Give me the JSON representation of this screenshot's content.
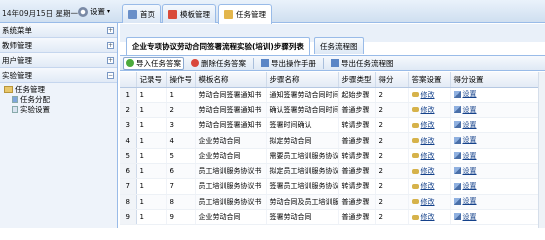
{
  "header": {
    "date_text": "14年09月15日 星期一",
    "settings_label": "设置"
  },
  "tabs": [
    {
      "label": "首页",
      "icon": "home-icon"
    },
    {
      "label": "模板管理",
      "icon": "pdf-icon"
    },
    {
      "label": "任务管理",
      "icon": "folder-icon"
    }
  ],
  "sidebar": {
    "sections": [
      {
        "label": "系统菜单",
        "toggle": "+"
      },
      {
        "label": "教师管理",
        "toggle": "+"
      },
      {
        "label": "用户管理",
        "toggle": "+"
      },
      {
        "label": "实验管理",
        "toggle": "−"
      }
    ],
    "tree": {
      "root": "任务管理",
      "children": [
        "任务分配",
        "实验设置"
      ]
    }
  },
  "subtabs": [
    {
      "label": "企业专项协议劳动合同签署流程实验(培训)步骤列表"
    },
    {
      "label": "任务流程图"
    }
  ],
  "toolbar": {
    "import_label": "导入任务答案",
    "delete_label": "删除任务答案",
    "export_ops_label": "导出操作手册",
    "export_flow_label": "导出任务流程图"
  },
  "table": {
    "headers": [
      "",
      "记录号",
      "操作号",
      "模板名称",
      "步骤名称",
      "步骤类型",
      "得分",
      "答案设置",
      "得分设置"
    ],
    "rows": [
      [
        "1",
        "1",
        "1",
        "劳动合同签署通知书",
        "通知签署劳动合同时间",
        "起始步骤",
        "2"
      ],
      [
        "2",
        "1",
        "2",
        "劳动合同签署通知书",
        "确认签署劳动合同时间",
        "普通步骤",
        "2"
      ],
      [
        "3",
        "1",
        "3",
        "劳动合同签署通知书",
        "签署时间确认",
        "转请步骤",
        "2"
      ],
      [
        "4",
        "1",
        "4",
        "企业劳动合同",
        "拟定劳动合同",
        "普通步骤",
        "2"
      ],
      [
        "5",
        "1",
        "5",
        "企业劳动合同",
        "需要员工培训服务协议书",
        "转请步骤",
        "2"
      ],
      [
        "6",
        "1",
        "6",
        "员工培训服务协议书",
        "拟定员工培训服务协议书",
        "普通步骤",
        "2"
      ],
      [
        "7",
        "1",
        "7",
        "员工培训服务协议书",
        "签署员工培训服务协议书",
        "转请步骤",
        "2"
      ],
      [
        "8",
        "1",
        "8",
        "员工培训服务协议书",
        "劳动合同及员工培训服务...",
        "普通步骤",
        "2"
      ],
      [
        "9",
        "1",
        "9",
        "企业劳动合同",
        "签署劳动合同",
        "普通步骤",
        "2"
      ]
    ],
    "answer_link": "修改",
    "score_link": "设置"
  }
}
